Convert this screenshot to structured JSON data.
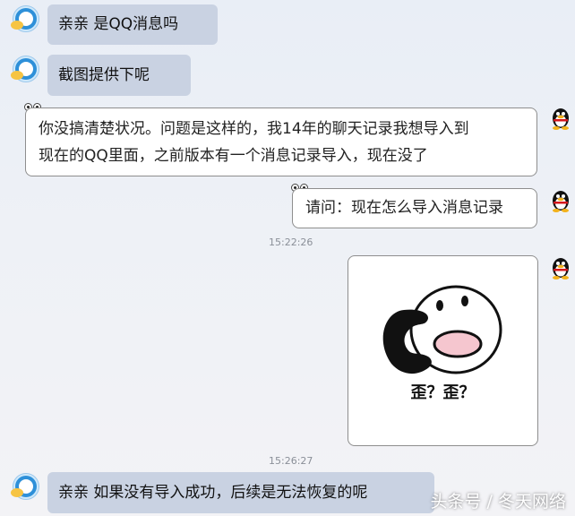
{
  "messages": [
    {
      "text": "亲亲 是QQ消息吗"
    },
    {
      "text": "截图提供下呢"
    },
    {
      "line1": "你没搞清楚状况。问题是这样的，我14年的聊天记录我想导入到",
      "line2": "现在的QQ里面，之前版本有一个消息记录导入，现在没了"
    },
    {
      "text": "请问：现在怎么导入消息记录"
    },
    {
      "sticker_caption": "歪？歪？"
    },
    {
      "text": "亲亲 如果没有导入成功，后续是无法恢复的呢"
    }
  ],
  "timestamps": [
    "15:22:26",
    "15:26:27"
  ],
  "watermark": "头条号 / 冬天网络",
  "icons": {
    "service_avatar": "service-agent-avatar-icon",
    "user_avatar": "qq-penguin-avatar-icon"
  }
}
